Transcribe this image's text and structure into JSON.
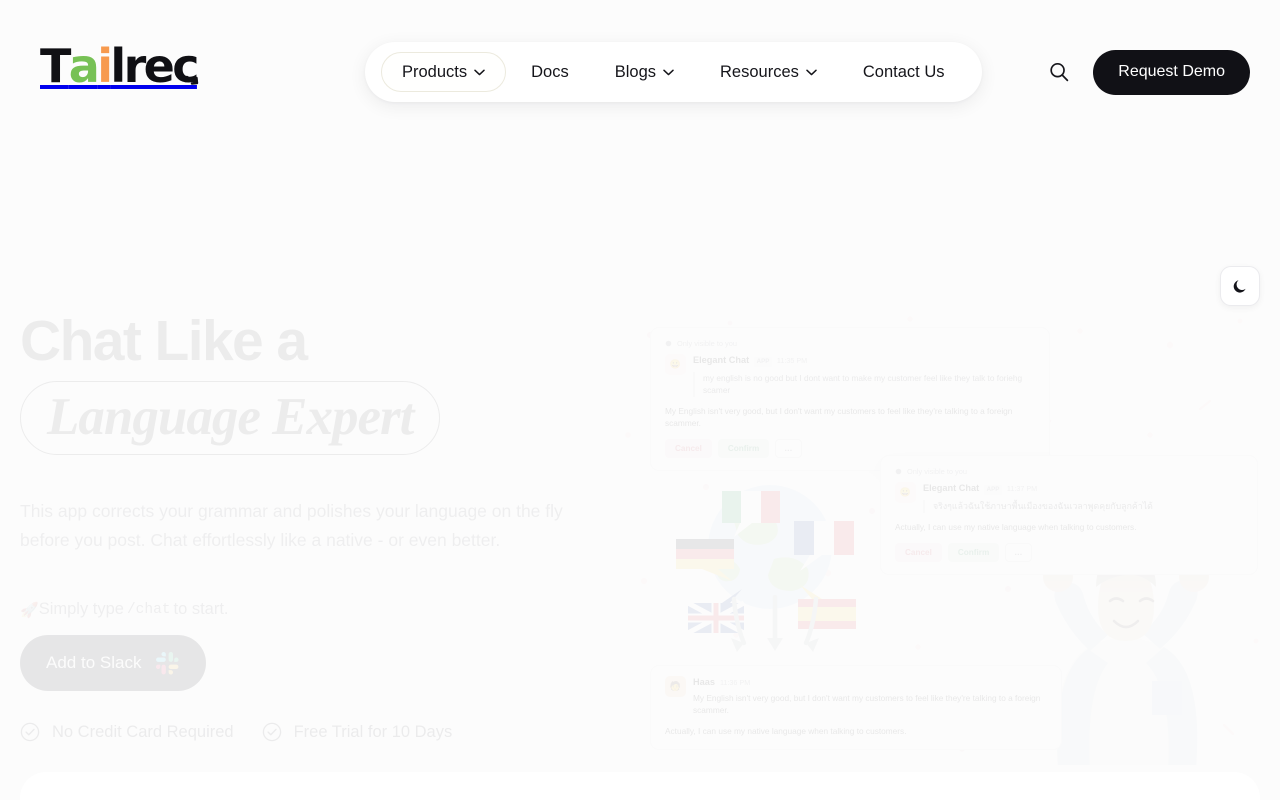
{
  "brand": {
    "name": "Tailrec",
    "logo_parts": {
      "t": "T",
      "a": "ai",
      "i": "i",
      "rest": "lrec"
    },
    "colors": {
      "green": "#77c155",
      "orange": "#f79a4e",
      "black": "#101014"
    }
  },
  "header": {
    "nav": [
      {
        "label": "Products",
        "has_caret": true,
        "active": true
      },
      {
        "label": "Docs",
        "has_caret": false,
        "active": false
      },
      {
        "label": "Blogs",
        "has_caret": true,
        "active": false
      },
      {
        "label": "Resources",
        "has_caret": true,
        "active": false
      },
      {
        "label": "Contact Us",
        "has_caret": false,
        "active": false
      }
    ],
    "search_icon": "search-icon",
    "cta_label": "Request Demo"
  },
  "theme_toggle": {
    "icon": "moon-icon",
    "mode": "dark"
  },
  "hero": {
    "heading_line1": "Chat Like a",
    "heading_line2": "Language Expert",
    "subtext": "This app corrects your grammar and polishes your language on the fly before you post. Chat effortlessly like a native - or even better.",
    "hint_emoji": "🚀",
    "hint_prefix": "Simply type ",
    "hint_command": "/chat",
    "hint_suffix": " to start.",
    "slack_button": "Add to Slack",
    "slack_icon": "slack-logo-icon",
    "perks": [
      {
        "icon": "check-circle-icon",
        "label": "No Credit Card Required"
      },
      {
        "icon": "check-circle-icon",
        "label": "Free Trial for 10 Days"
      }
    ]
  },
  "artwork": {
    "globe_icon": "globe-with-flag-speech-bubbles",
    "flags": [
      "Italy",
      "France",
      "Germany",
      "United Kingdom",
      "Spain"
    ],
    "arrows_icon": "three-down-arrows",
    "person_icon": "celebrating-person-illustration",
    "cards": [
      {
        "only_visible": "Only visible to you",
        "name": "Elegant Chat",
        "tag": "APP",
        "time": "11:35 PM",
        "quote": "my english is no good but I dont want to make my customer feel like they talk to foriehg scamer",
        "translated": "My English isn't very good, but I don't want my customers to feel like they're talking to a foreign scammer.",
        "cancel": "Cancel",
        "confirm": "Confirm",
        "more": "…"
      },
      {
        "only_visible": "Only visible to you",
        "name": "Elegant Chat",
        "tag": "APP",
        "time": "11:37 PM",
        "quote": "จริงๆแล้วฉันใช้ภาษาพื้นเมืองของฉันเวลาพูดคุยกับลูกค้าได้",
        "translated": "Actually, I can use my native language when talking to customers.",
        "cancel": "Cancel",
        "confirm": "Confirm",
        "more": "…"
      },
      {
        "name": "Haas",
        "time": "11:36 PM",
        "line1": "My English isn't very good, but I don't want my customers to feel like they're talking to a foreign scammer.",
        "line2": "Actually, I can use my native language when talking to customers."
      }
    ]
  }
}
